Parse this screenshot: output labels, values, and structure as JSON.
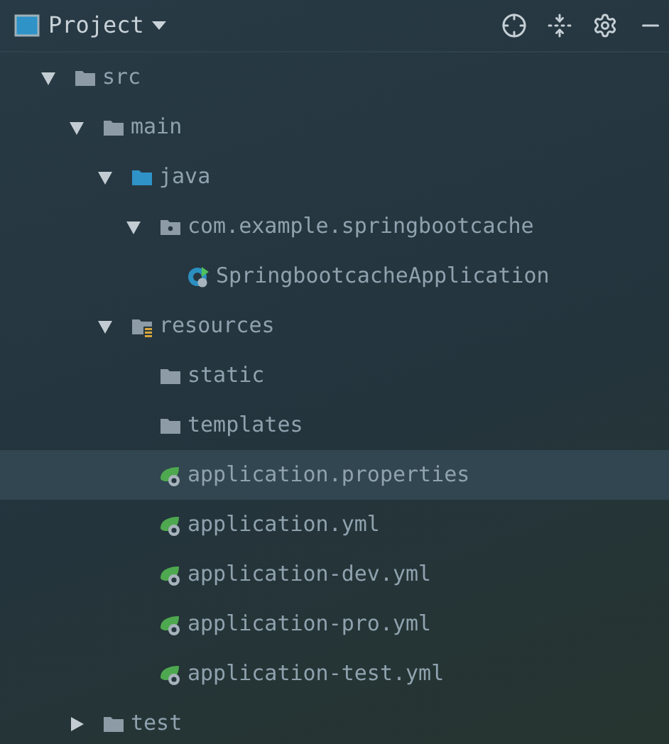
{
  "panel": {
    "title": "Project"
  },
  "tree": [
    {
      "label": "src",
      "kind": "folder",
      "expanded": true,
      "selected": false,
      "children": [
        {
          "label": "main",
          "kind": "folder",
          "expanded": true,
          "selected": false,
          "children": [
            {
              "label": "java",
              "kind": "source-folder",
              "expanded": true,
              "selected": false,
              "children": [
                {
                  "label": "com.example.springbootcache",
                  "kind": "package",
                  "expanded": true,
                  "selected": false,
                  "children": [
                    {
                      "label": "SpringbootcacheApplication",
                      "kind": "spring-class",
                      "selected": false
                    }
                  ]
                }
              ]
            },
            {
              "label": "resources",
              "kind": "resources-folder",
              "expanded": true,
              "selected": false,
              "children": [
                {
                  "label": "static",
                  "kind": "folder",
                  "selected": false
                },
                {
                  "label": "templates",
                  "kind": "folder",
                  "selected": false
                },
                {
                  "label": "application.properties",
                  "kind": "spring-config",
                  "selected": true
                },
                {
                  "label": "application.yml",
                  "kind": "spring-config",
                  "selected": false
                },
                {
                  "label": "application-dev.yml",
                  "kind": "spring-config",
                  "selected": false
                },
                {
                  "label": "application-pro.yml",
                  "kind": "spring-config",
                  "selected": false
                },
                {
                  "label": "application-test.yml",
                  "kind": "spring-config",
                  "selected": false
                }
              ]
            }
          ]
        },
        {
          "label": "test",
          "kind": "folder",
          "expanded": false,
          "selected": false
        }
      ]
    }
  ]
}
